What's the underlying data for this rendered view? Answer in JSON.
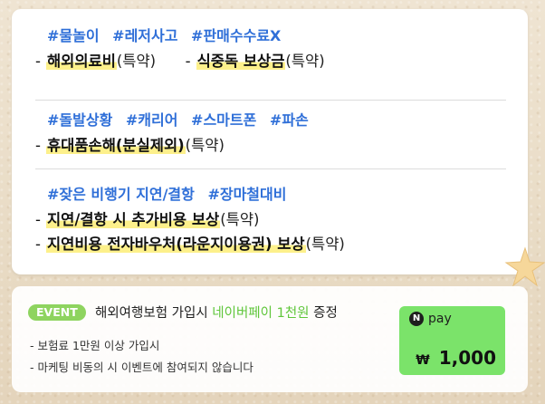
{
  "sections": [
    {
      "tags": [
        "#물놀이",
        "#레저사고",
        "#판매수수료X"
      ],
      "rows": [
        {
          "left": {
            "bold": "해외의료비",
            "suffix": "(특약)"
          },
          "right": {
            "bold": "식중독 보상금",
            "suffix": "(특약)"
          }
        }
      ]
    },
    {
      "tags": [
        "#돌발상황",
        "#캐리어",
        "#스마트폰",
        "#파손"
      ],
      "rows": [
        {
          "left": {
            "bold": "휴대품손해(분실제외)",
            "suffix": "(특약)"
          }
        }
      ]
    },
    {
      "tags": [
        "#잦은 비행기 지연/결항",
        "#장마철대비"
      ],
      "rows": [
        {
          "left": {
            "bold": "지연/결항 시 추가비용 보상",
            "suffix": "(특약)"
          }
        },
        {
          "left": {
            "bold": "지연비용 전자바우처(라운지이용권) 보상",
            "suffix": "(특약)"
          }
        }
      ]
    }
  ],
  "dash": "-",
  "event": {
    "badge": "EVENT",
    "title_prefix": "해외여행보험 가입시 ",
    "title_highlight": "네이버페이 1천원",
    "title_suffix": " 증정",
    "notes": [
      "- 보험료 1만원 이상 가입시",
      "- 마케팅 비동의 시 이벤트에 참여되지 않습니다"
    ],
    "npay": {
      "logo_letter": "N",
      "label": "pay",
      "currency": "₩",
      "amount": "1,000"
    }
  },
  "colors": {
    "tag": "#2f6fd8",
    "highlight": "#fdf08b",
    "badge": "#8ed45f",
    "npay_bg": "#7be36a"
  }
}
